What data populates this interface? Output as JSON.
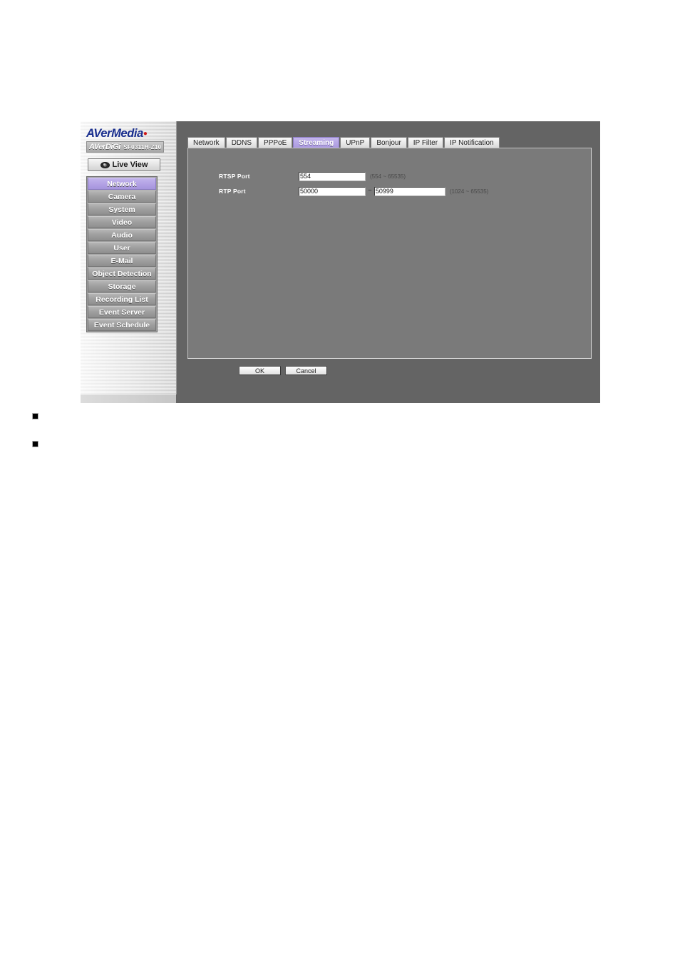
{
  "branding": {
    "logo_main": "AVerMedia",
    "logo_brand": "AVerDiGi",
    "logo_model": "SF0311H-Z10"
  },
  "sidebar": {
    "live_view_label": "Live View",
    "live_view_icon": "eye-icon",
    "items": [
      {
        "label": "Network",
        "active": true
      },
      {
        "label": "Camera",
        "active": false
      },
      {
        "label": "System",
        "active": false
      },
      {
        "label": "Video",
        "active": false
      },
      {
        "label": "Audio",
        "active": false
      },
      {
        "label": "User",
        "active": false
      },
      {
        "label": "E-Mail",
        "active": false
      },
      {
        "label": "Object Detection",
        "active": false
      },
      {
        "label": "Storage",
        "active": false
      },
      {
        "label": "Recording List",
        "active": false
      },
      {
        "label": "Event Server",
        "active": false
      },
      {
        "label": "Event Schedule",
        "active": false
      }
    ]
  },
  "tabs": [
    {
      "label": "Network",
      "active": false
    },
    {
      "label": "DDNS",
      "active": false
    },
    {
      "label": "PPPoE",
      "active": false
    },
    {
      "label": "Streaming",
      "active": true
    },
    {
      "label": "UPnP",
      "active": false
    },
    {
      "label": "Bonjour",
      "active": false
    },
    {
      "label": "IP Filter",
      "active": false
    },
    {
      "label": "IP Notification",
      "active": false
    }
  ],
  "form": {
    "rtsp": {
      "label": "RTSP Port",
      "value": "554",
      "hint": "(554 ~ 65535)"
    },
    "rtp": {
      "label": "RTP Port",
      "start_value": "50000",
      "end_value": "50999",
      "separator": "~",
      "hint": "(1024 ~ 65535)"
    }
  },
  "buttons": {
    "ok_label": "OK",
    "cancel_label": "Cancel"
  },
  "colors": {
    "accent_purple": "#ab9ae0",
    "panel_gray": "#7a7a7a",
    "frame_gray": "#646464",
    "logo_blue": "#1a2f8f"
  }
}
